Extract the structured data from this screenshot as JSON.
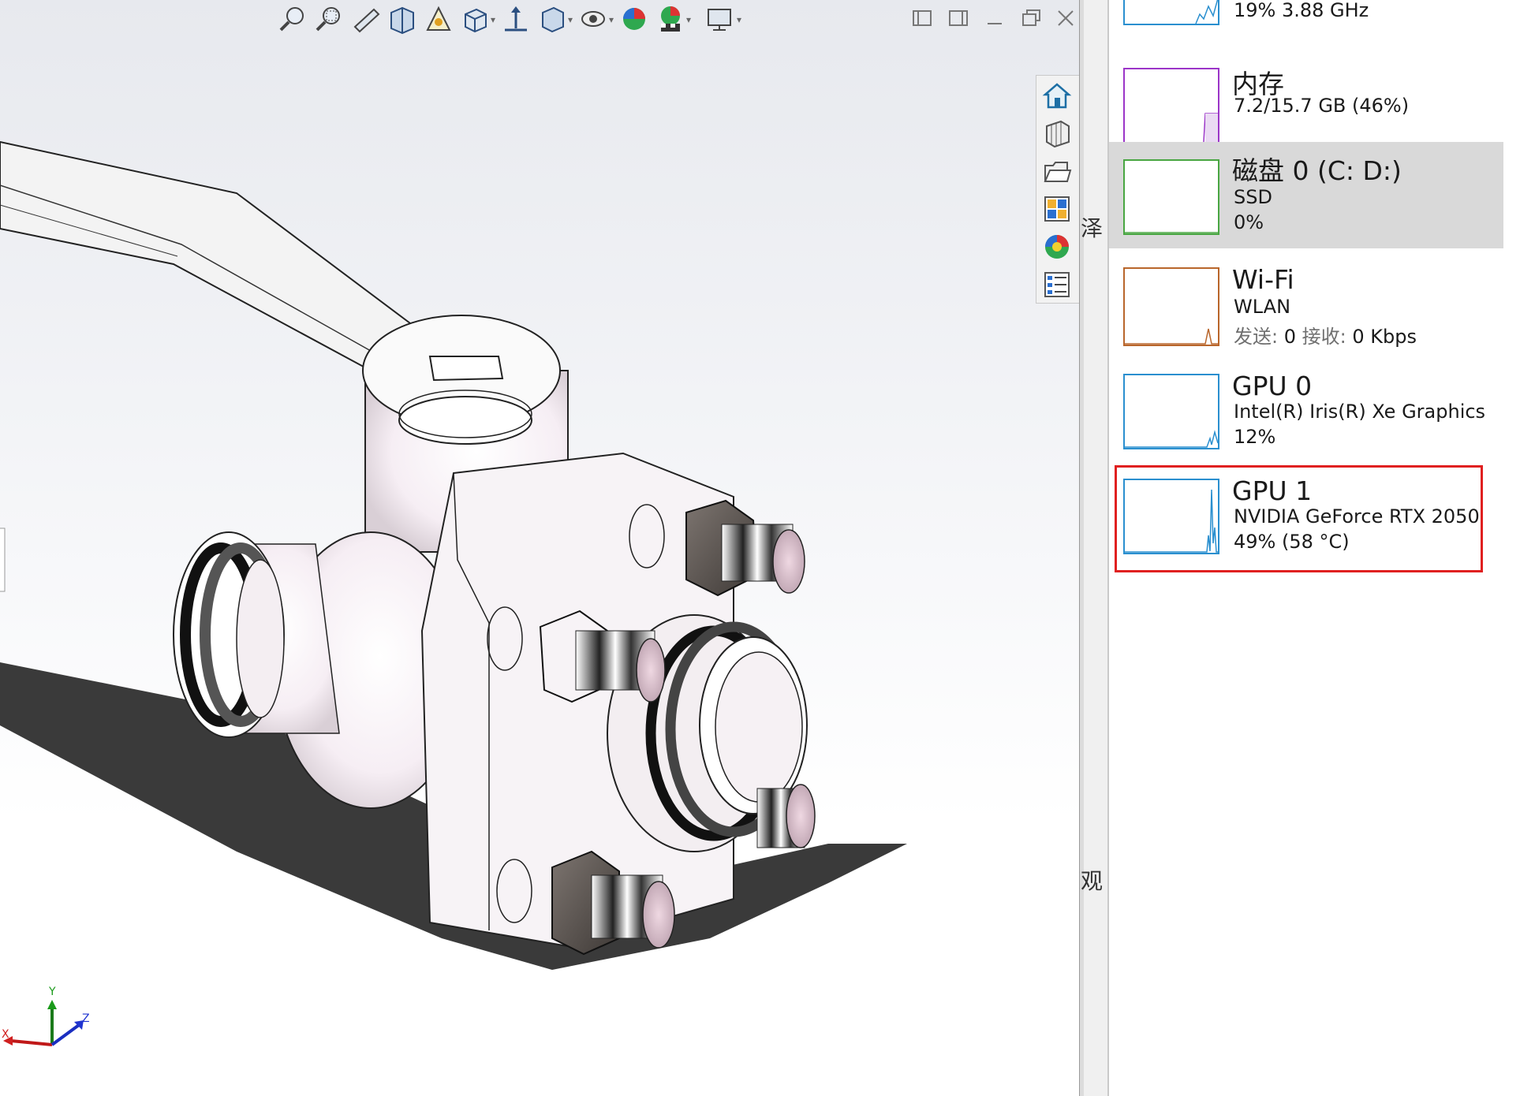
{
  "cad": {
    "toolbar_icons": [
      "zoom-to-fit-icon",
      "zoom-area-icon",
      "previous-view-icon",
      "section-view-icon",
      "dynamic-annotation-icon",
      "view-orientation-icon",
      "display-style-icon",
      "hide-show-icon",
      "edit-appearance-icon",
      "apply-scene-icon",
      "view-settings-icon"
    ],
    "window_buttons": [
      "split-left-icon",
      "split-right-icon",
      "minimize-icon",
      "restore-icon",
      "close-icon"
    ],
    "task_pane_icons": [
      "home-icon",
      "design-library-icon",
      "file-explorer-icon",
      "view-palette-icon",
      "appearances-icon",
      "custom-properties-icon"
    ],
    "triad": {
      "x": "X",
      "y": "Y",
      "z": "Z"
    }
  },
  "gap_chars": {
    "top": "泽",
    "bottom": "观"
  },
  "task_manager": {
    "accent_cpu": "#2a8fcf",
    "cpu": {
      "line": "19%  3.88 GHz"
    },
    "memory": {
      "title": "内存",
      "line": "7.2/15.7 GB (46%)",
      "color": "#9b35c8"
    },
    "disk": {
      "title": "磁盘 0 (C: D:)",
      "line1": "SSD",
      "line2": "0%",
      "color": "#49a642"
    },
    "wifi": {
      "title": "Wi-Fi",
      "line1": "WLAN",
      "send_label": "发送:",
      "send_value": "0",
      "recv_label": "接收:",
      "recv_value": "0 Kbps",
      "color": "#b9662b"
    },
    "gpu0": {
      "title": "GPU 0",
      "line1": "Intel(R) Iris(R) Xe Graphics",
      "line2": "12%",
      "color": "#2a8fcf"
    },
    "gpu1": {
      "title": "GPU 1",
      "line1": "NVIDIA GeForce RTX 2050",
      "line2": "49%  (58 °C)",
      "color": "#2a8fcf"
    },
    "highlight_color": "#e02020"
  }
}
